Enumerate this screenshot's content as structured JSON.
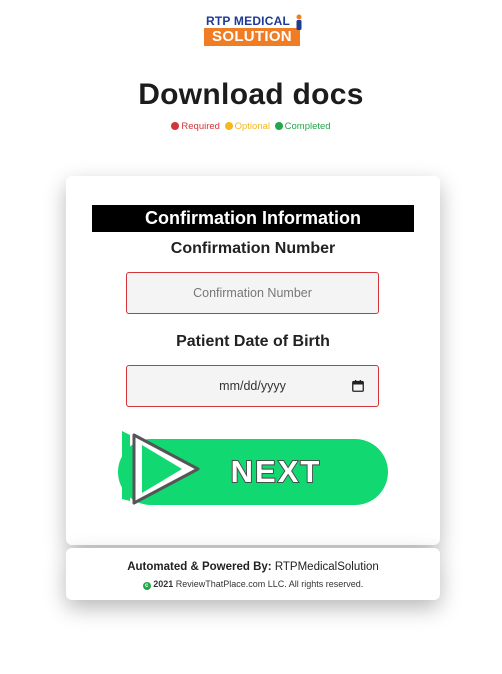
{
  "brand": {
    "line1": "RTP MEDICAL",
    "line2": "SOLUTION",
    "colors": {
      "navy": "#1f3a93",
      "orange": "#f07d24"
    }
  },
  "page": {
    "title": "Download docs"
  },
  "legend": [
    {
      "label": "Required",
      "color": "#d3343a"
    },
    {
      "label": "Optional",
      "color": "#f5b820"
    },
    {
      "label": "Completed",
      "color": "#22a84a"
    }
  ],
  "form": {
    "section_title": "Confirmation Information",
    "confirmation": {
      "label": "Confirmation Number",
      "placeholder": "Confirmation Number",
      "value": ""
    },
    "dob": {
      "label": "Patient Date of Birth",
      "value": "mm/dd/yyyy"
    },
    "next": {
      "label": "NEXT",
      "color": "#12d872"
    }
  },
  "footer": {
    "powered_prefix": "Automated & Powered By:",
    "powered_name": "RTPMedicalSolution",
    "year": "2021",
    "rights": "ReviewThatPlace.com LLC. All rights reserved."
  }
}
